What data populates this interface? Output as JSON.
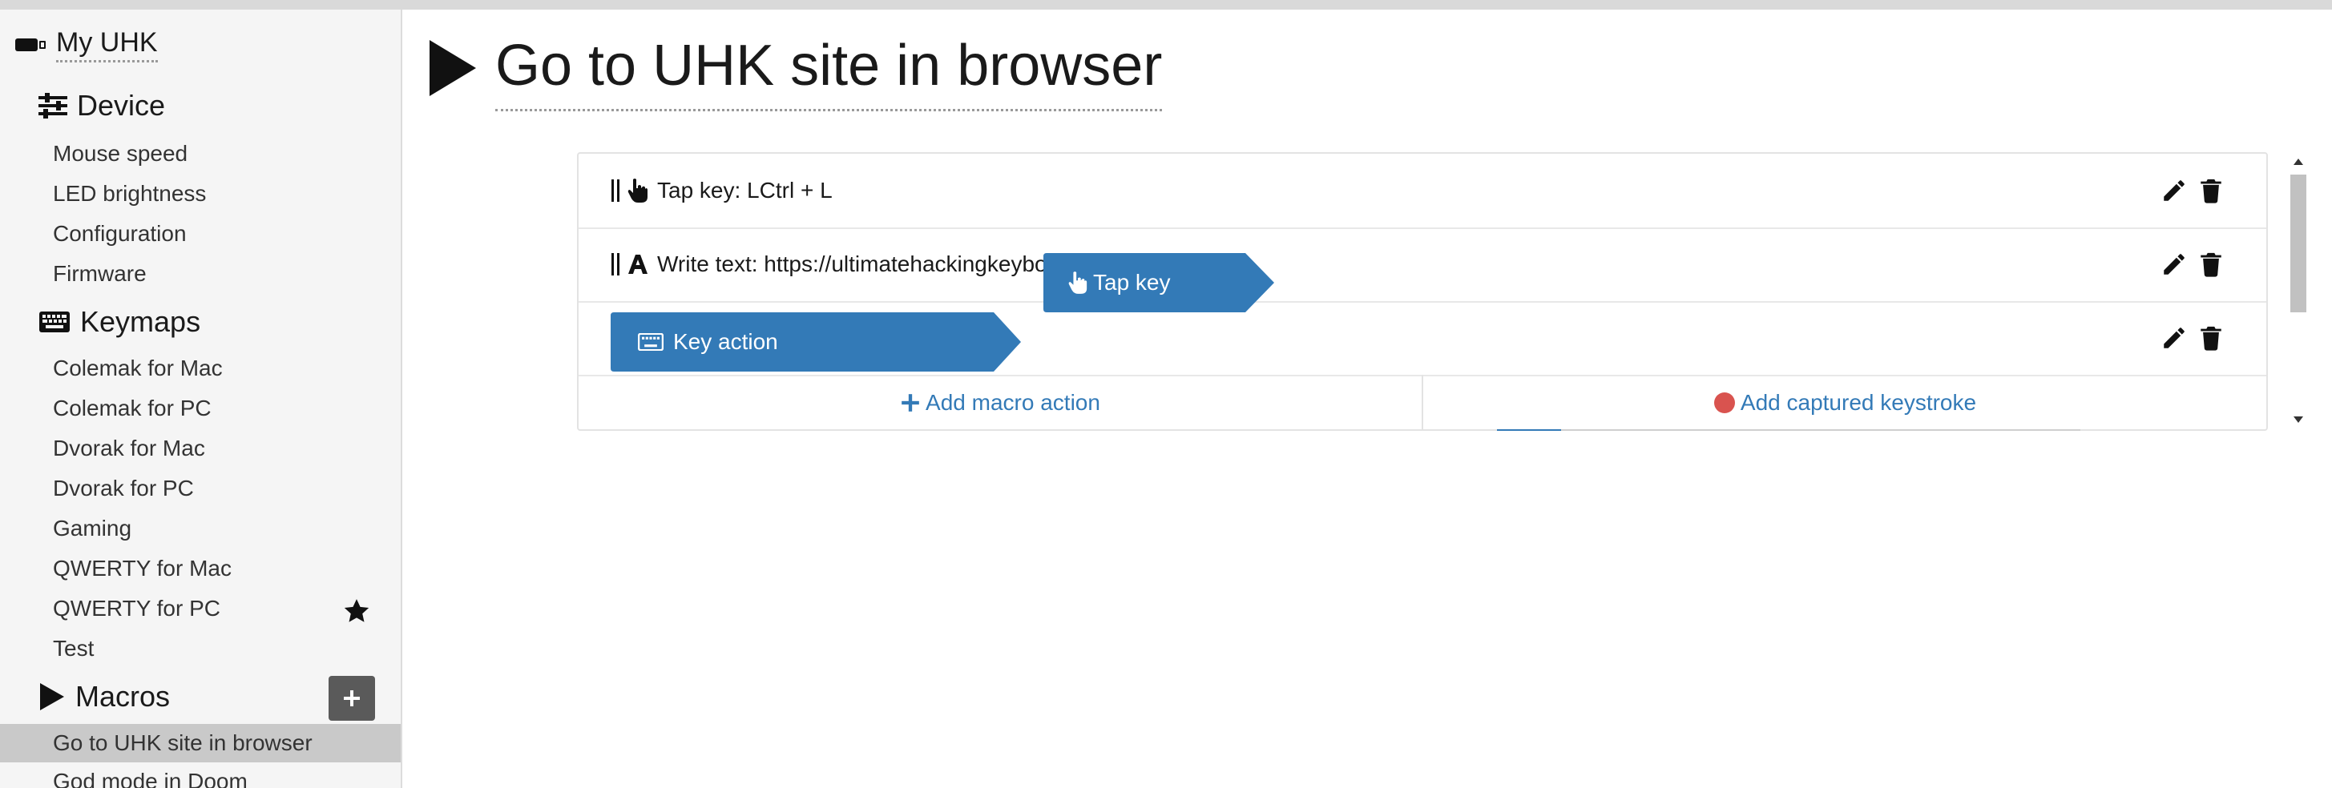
{
  "sidebar": {
    "root_label": "My UHK",
    "sections": {
      "device": {
        "label": "Device",
        "items": [
          "Mouse speed",
          "LED brightness",
          "Configuration",
          "Firmware"
        ]
      },
      "keymaps": {
        "label": "Keymaps",
        "items": [
          "Colemak for Mac",
          "Colemak for PC",
          "Dvorak for Mac",
          "Dvorak for PC",
          "Gaming",
          "QWERTY for Mac",
          "QWERTY for PC",
          "Test"
        ]
      },
      "macros": {
        "label": "Macros",
        "items": [
          "Go to UHK site in browser",
          "God mode in Doom"
        ]
      }
    }
  },
  "main": {
    "title": "Go to UHK site in browser",
    "actions": [
      {
        "label": "Tap key: LCtrl + L",
        "icon": "hand-pointer-icon"
      },
      {
        "label": "Write text: https://ultimatehackingkeybo",
        "icon": "font-icon"
      }
    ],
    "drag_overlay": {
      "label": "Tap key"
    },
    "key_action": {
      "label": "Key action"
    },
    "footer": {
      "add_macro_action": "Add macro action",
      "add_captured_keystroke": "Add captured keystroke"
    }
  },
  "colors": {
    "accent": "#337ab7",
    "record": "#d9534f",
    "selected": "#c9c9c9"
  }
}
